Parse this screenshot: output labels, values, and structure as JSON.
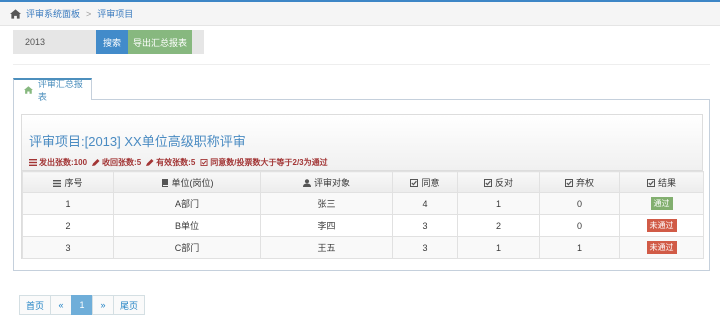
{
  "breadcrumb": {
    "home_label": "评审系统面板",
    "separator": ">",
    "current": "评审项目"
  },
  "search": {
    "value": "2013",
    "search_label": "搜索",
    "export_label": "导出汇总报表"
  },
  "tab": {
    "label": "评审汇总报表"
  },
  "report": {
    "title": "评审项目:[2013] XX单位高级职称评审",
    "stats": {
      "issued_label": "发出张数:",
      "issued_value": "100",
      "returned_label": "收回张数:",
      "returned_value": "5",
      "valid_label": "有效张数:",
      "valid_value": "5",
      "rule": "同意数/投票数大于等于2/3为通过"
    }
  },
  "table": {
    "headers": {
      "no": "序号",
      "unit": "单位(岗位)",
      "target": "评审对象",
      "agree": "同意",
      "oppose": "反对",
      "abstain": "弃权",
      "result": "结果"
    },
    "rows": [
      {
        "no": "1",
        "unit": "A部门",
        "target": "张三",
        "agree": "4",
        "oppose": "1",
        "abstain": "0",
        "result": "通过",
        "status": "pass"
      },
      {
        "no": "2",
        "unit": "B单位",
        "target": "李四",
        "agree": "3",
        "oppose": "2",
        "abstain": "0",
        "result": "未通过",
        "status": "fail"
      },
      {
        "no": "3",
        "unit": "C部门",
        "target": "王五",
        "agree": "3",
        "oppose": "1",
        "abstain": "1",
        "result": "未通过",
        "status": "fail"
      }
    ]
  },
  "pagination": {
    "first": "首页",
    "prev": "«",
    "current": "1",
    "next": "»",
    "last": "尾页"
  },
  "colors": {
    "accent": "#428bca",
    "export": "#87b87f",
    "pass": "#82af6f",
    "fail": "#d15b47",
    "title": "#4a8bc2",
    "stats": "#a23535"
  }
}
